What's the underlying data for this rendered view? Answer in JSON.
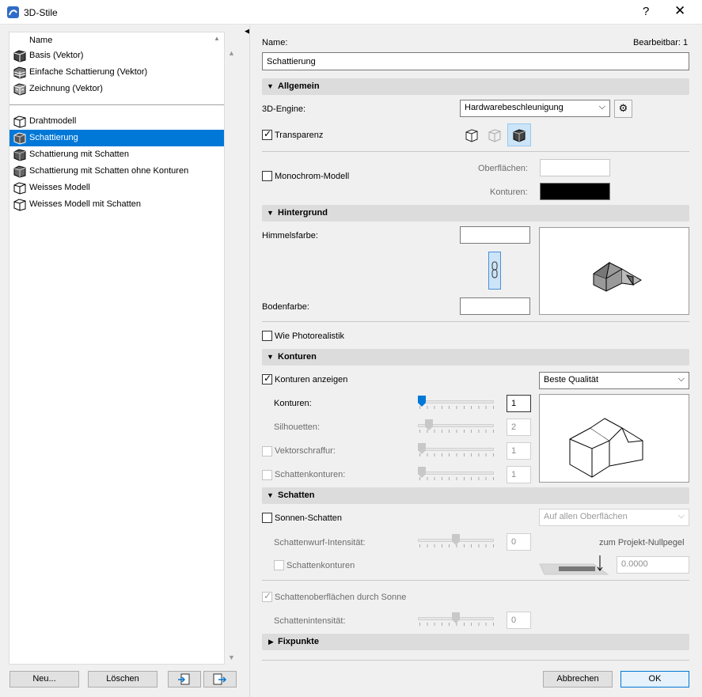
{
  "window": {
    "title": "3D-Stile",
    "help": "?",
    "close": "✕"
  },
  "list": {
    "header": "Name",
    "group1": [
      "Basis (Vektor)",
      "Einfache Schattierung (Vektor)",
      "Zeichnung (Vektor)"
    ],
    "group2": [
      "Drahtmodell",
      "Schattierung",
      "Schattierung mit Schatten",
      "Schattierung mit Schatten ohne Konturen",
      "Weisses Modell",
      "Weisses Modell mit Schatten"
    ],
    "selected": "Schattierung"
  },
  "left_buttons": {
    "new": "Neu...",
    "delete": "Löschen"
  },
  "name": {
    "label": "Name:",
    "editable": "Bearbeitbar: 1",
    "value": "Schattierung"
  },
  "allgemein": {
    "title": "Allgemein",
    "engine_label": "3D-Engine:",
    "engine_value": "Hardwarebeschleunigung",
    "transparency_label": "Transparenz",
    "transparency_checked": true
  },
  "mono": {
    "label": "Monochrom-Modell",
    "surfaces_label": "Oberflächen:",
    "contours_label": "Konturen:",
    "surface_color": "#ffffff",
    "contour_color": "#000000"
  },
  "hintergrund": {
    "title": "Hintergrund",
    "sky_label": "Himmelsfarbe:",
    "ground_label": "Bodenfarbe:",
    "photorealistic_label": "Wie Photorealistik"
  },
  "konturen": {
    "title": "Konturen",
    "show_label": "Konturen anzeigen",
    "quality_value": "Beste Qualität",
    "contours_label": "Konturen:",
    "contours_value": "1",
    "silhouettes_label": "Silhouetten:",
    "silhouettes_value": "2",
    "vector_label": "Vektorschraffur:",
    "vector_value": "1",
    "shadow_contours_label": "Schattenkonturen:",
    "shadow_contours_value": "1"
  },
  "schatten": {
    "title": "Schatten",
    "sun_label": "Sonnen-Schatten",
    "sun_mode": "Auf allen Oberflächen",
    "intensity_label": "Schattenwurf-Intensität:",
    "intensity_value": "0",
    "contours_label": "Schattenkonturen",
    "zero_label": "zum Projekt-Nullpegel",
    "zero_value": "0.0000",
    "sun_surfaces_label": "Schattenoberflächen durch Sonne",
    "shadow_intensity_label": "Schattenintensität:",
    "shadow_intensity_value": "0"
  },
  "fixpunkte": {
    "title": "Fixpunkte"
  },
  "footer": {
    "cancel": "Abbrechen",
    "ok": "OK"
  },
  "colors": {
    "accent": "#0078d7",
    "section_bg": "#dcdcdc"
  }
}
